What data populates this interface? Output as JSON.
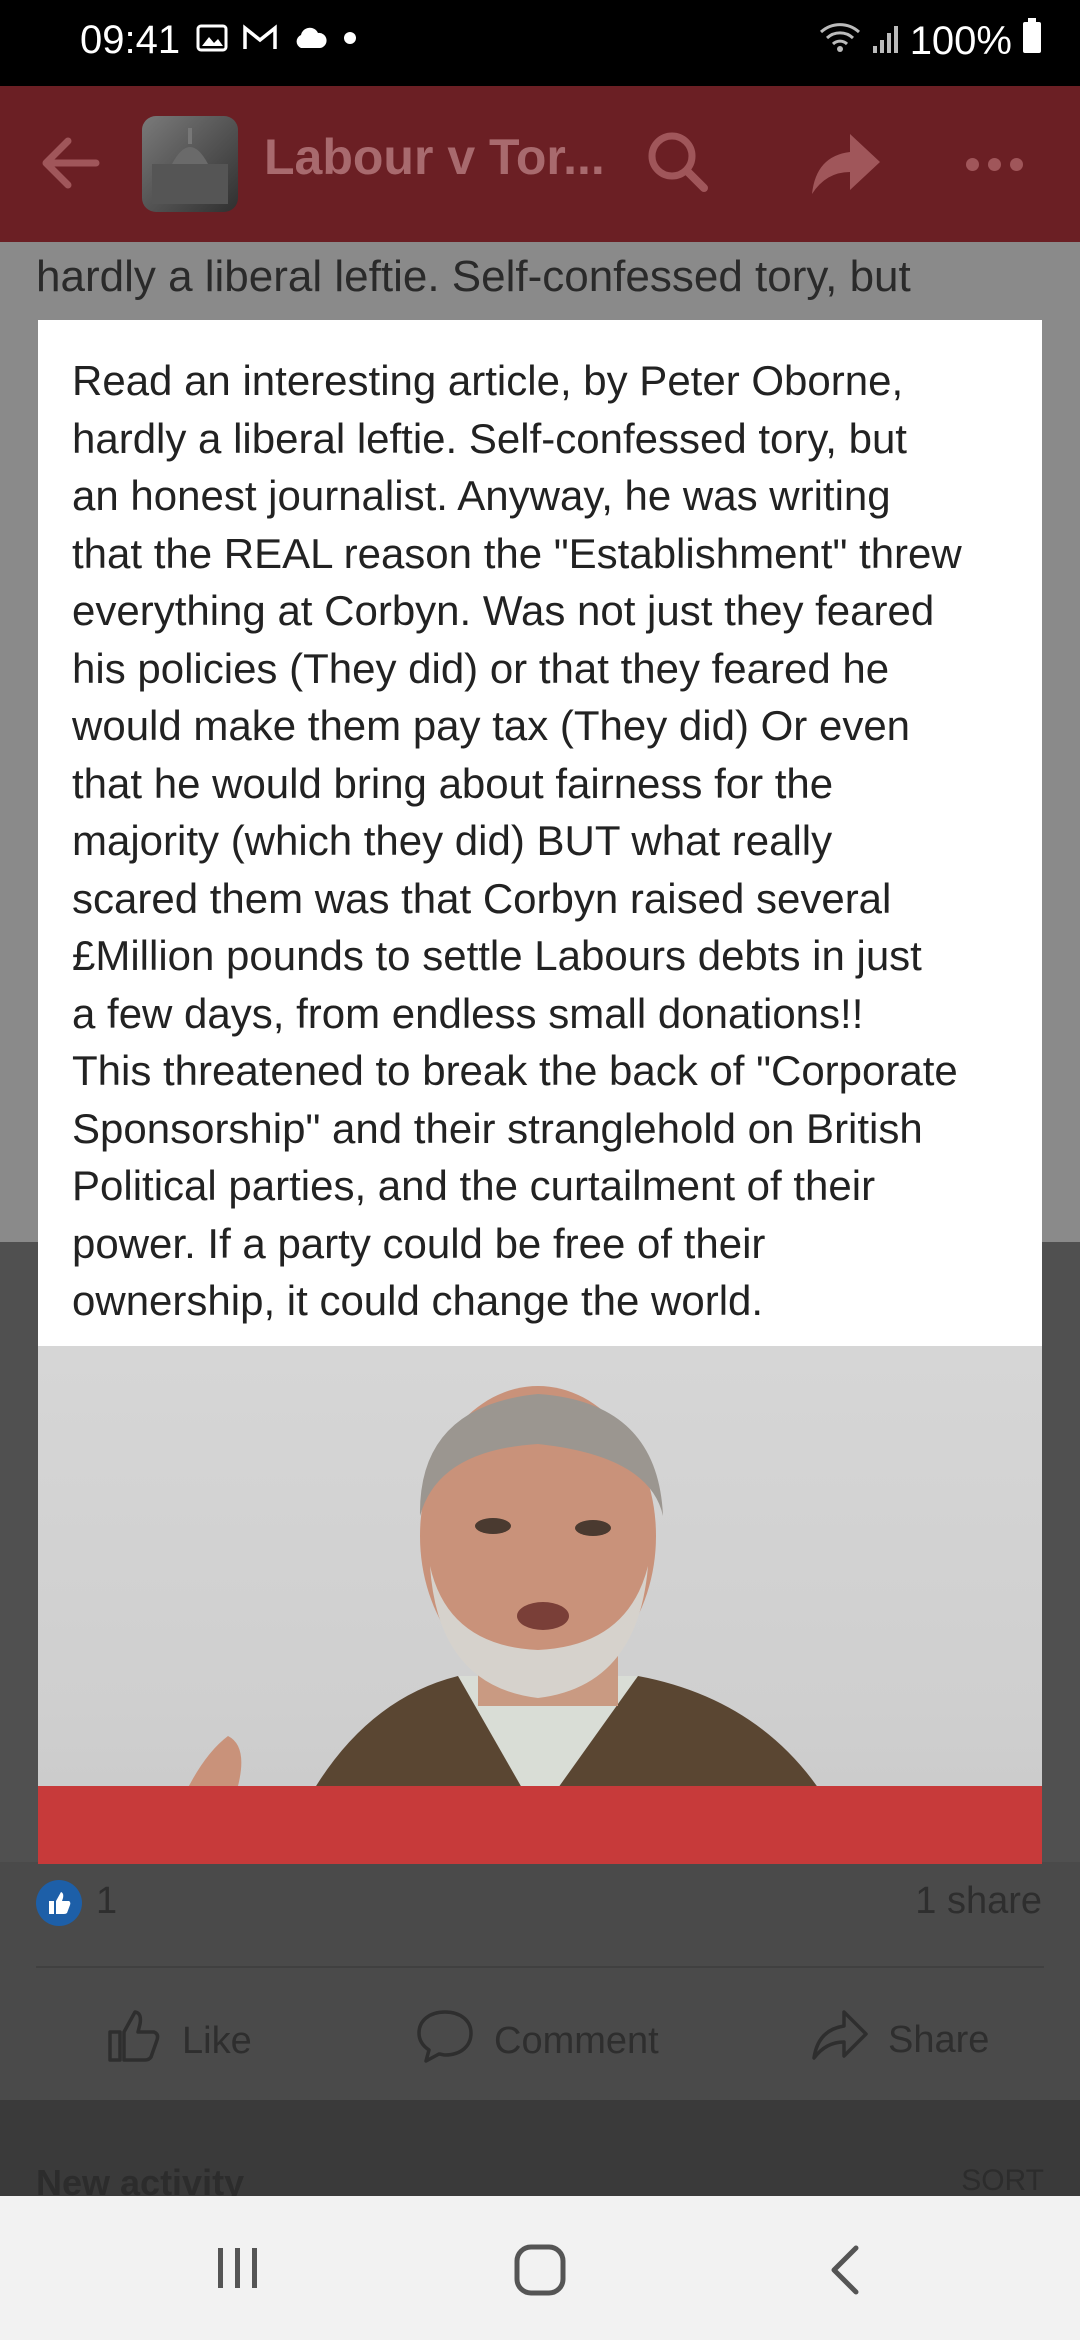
{
  "status_bar": {
    "time": "09:41",
    "battery": "100%",
    "icons": [
      "gallery-icon",
      "gmail-icon",
      "cloud-icon",
      "dot-icon",
      "wifi-icon",
      "signal-icon",
      "battery-icon"
    ]
  },
  "app_bar": {
    "title": "Labour v Tor...",
    "icons": [
      "back-arrow-icon",
      "search-icon",
      "share-arrow-icon",
      "more-icon"
    ],
    "color": "#6b1f24"
  },
  "behind_text": "hardly a liberal leftie.  Self-confessed tory, but",
  "post": {
    "text_lines": [
      "Read an interesting article, by Peter Oborne,",
      "hardly a liberal leftie.  Self-confessed tory, but",
      "an honest journalist.  Anyway, he was writing",
      "that the REAL reason the \"Establishment\" threw",
      "everything at Corbyn.  Was not just they feared",
      "his policies (They did) or that they feared he",
      "would make them pay tax (They did) Or even",
      "that he would bring about fairness for the",
      "majority (which they did)  BUT what really",
      "scared them was that Corbyn raised several",
      "£Million pounds to settle Labours debts in just",
      "a few days, from endless small donations!!",
      "This threatened to break the back of \"Corporate",
      "Sponsorship\" and their stranglehold on British",
      "Political parties, and the curtailment of their",
      "power.  If a party could be free of their",
      "ownership, it could change the world."
    ]
  },
  "reactions": {
    "like_count": "1",
    "share_count": "1 share"
  },
  "actions": {
    "like": "Like",
    "comment": "Comment",
    "share": "Share"
  },
  "new_activity": {
    "label": "New activity",
    "sort": "SORT"
  },
  "nav": {
    "icons": [
      "recents-icon",
      "home-icon",
      "back-icon"
    ]
  }
}
